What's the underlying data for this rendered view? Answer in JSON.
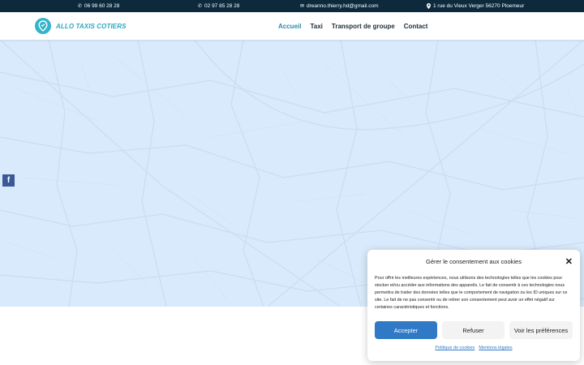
{
  "topbar": {
    "phone1": "06 99 60 28 28",
    "phone2": "02 97 85 28 28",
    "email": "dreanno.thierry.hd@gmail.com",
    "address": "1 rue du Vieux Verger 56270 Ploemeur",
    "icons": [
      "phone-icon",
      "phone-icon",
      "email-icon",
      "location-pin-icon"
    ]
  },
  "header": {
    "logo_text": "ALLO TAXIS COTIERS",
    "nav": [
      {
        "label": "Accueil",
        "active": true
      },
      {
        "label": "Taxi",
        "active": false
      },
      {
        "label": "Transport de groupe",
        "active": false
      },
      {
        "label": "Contact",
        "active": false
      }
    ]
  },
  "social": {
    "facebook_label": "f"
  },
  "consent": {
    "title": "Gérer le consentement aux cookies",
    "close_label": "✕",
    "body": "Pour offrir les meilleures expériences, nous utilisons des technologies telles que les cookies pour stocker et/ou accéder aux informations des appareils. Le fait de consentir à ces technologies nous permettra de traiter des données telles que le comportement de navigation ou les ID uniques sur ce site. Le fait de ne pas consentir ou de retirer son consentement peut avoir un effet négatif sur certaines caractéristiques et fonctions.",
    "accept_label": "Accepter",
    "refuse_label": "Refuser",
    "prefs_label": "Voir les préférences",
    "links": [
      "Politique de cookies",
      "Mentions légales"
    ]
  },
  "colors": {
    "topbar_bg": "#0d2a3d",
    "brand": "#2aa8c3",
    "nav_active": "#2b8ab0",
    "map_bg": "#d8eafb",
    "accept_bg": "#2f79c7",
    "facebook": "#3b5998"
  }
}
